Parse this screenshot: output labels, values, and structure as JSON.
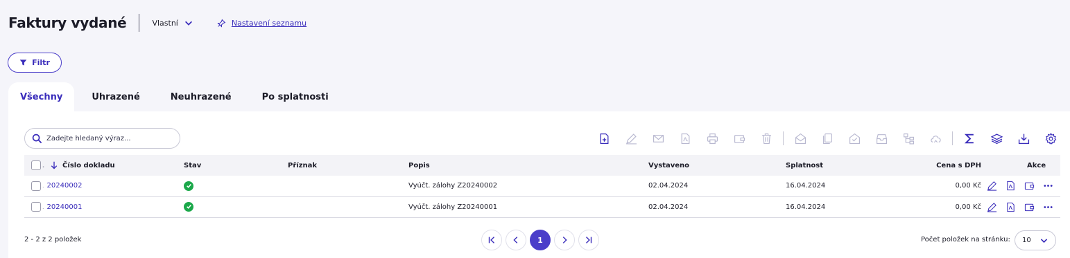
{
  "header": {
    "title": "Faktury vydané",
    "view_label": "Vlastní",
    "settings_link": "Nastavení seznamu"
  },
  "filter": {
    "label": "Filtr"
  },
  "tabs": [
    {
      "label": "Všechny",
      "active": true
    },
    {
      "label": "Uhrazené",
      "active": false
    },
    {
      "label": "Neuhrazené",
      "active": false
    },
    {
      "label": "Po splatnosti",
      "active": false
    }
  ],
  "search": {
    "placeholder": "Zadejte hledaný výraz..."
  },
  "toolbar_icons": [
    "new-document-icon",
    "edit-icon",
    "email-icon",
    "pdf-icon",
    "print-icon",
    "wallet-icon",
    "delete-icon",
    "open-envelope-icon",
    "copy-icon",
    "envelope-check-icon",
    "archive-icon",
    "hierarchy-icon",
    "cloud-sync-icon",
    "sum-icon",
    "layers-icon",
    "download-icon",
    "settings-icon"
  ],
  "table": {
    "columns": {
      "number": "Číslo dokladu",
      "status": "Stav",
      "flag": "Příznak",
      "description": "Popis",
      "issued": "Vystaveno",
      "due": "Splatnost",
      "price": "Cena s DPH",
      "actions": "Akce"
    },
    "rows": [
      {
        "number": "20240002",
        "status": "paid",
        "flag": "",
        "description": "Vyúčt. zálohy Z20240002",
        "issued": "02.04.2024",
        "due": "16.04.2024",
        "price": "0,00 Kč"
      },
      {
        "number": "20240001",
        "status": "paid",
        "flag": "",
        "description": "Vyúčt. zálohy Z20240001",
        "issued": "02.04.2024",
        "due": "16.04.2024",
        "price": "0,00 Kč"
      }
    ]
  },
  "pagination": {
    "info": "2 - 2 z 2 položek",
    "current_page": "1",
    "per_page_label": "Počet položek na stránku:",
    "per_page_value": "10"
  },
  "colors": {
    "accent": "#4a3ec9",
    "success": "#1ba84a",
    "background": "#f5f5fa"
  }
}
